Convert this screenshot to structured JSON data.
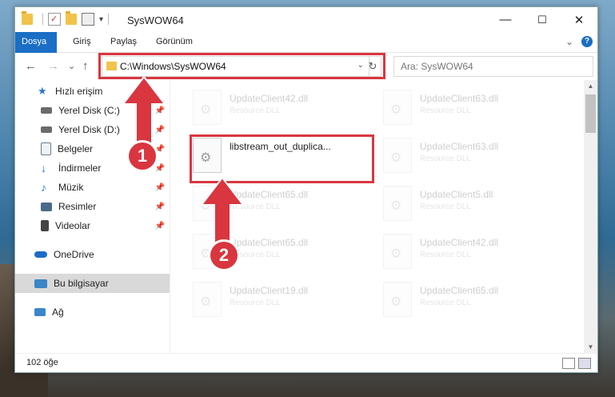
{
  "window": {
    "title": "SysWOW64",
    "controls": {
      "minimize": "—",
      "maximize": "☐",
      "close": "✕"
    }
  },
  "ribbon": {
    "tabs": [
      "Dosya",
      "Giriş",
      "Paylaş",
      "Görünüm"
    ],
    "chevron": "⌄",
    "help": "?"
  },
  "nav": {
    "back": "←",
    "forward": "→",
    "recent": "⌄",
    "up": "↑",
    "address": "C:\\Windows\\SysWOW64",
    "address_chevron": "⌄",
    "refresh": "↻",
    "search_placeholder": "Ara: SysWOW64"
  },
  "sidebar": {
    "items": [
      {
        "label": "Hızlı erişim",
        "icon": "star-icon",
        "color": "#2f78c8"
      },
      {
        "label": "Yerel Disk (C:)",
        "icon": "drive-icon",
        "color": "#555555",
        "pinned": true
      },
      {
        "label": "Yerel Disk (D:)",
        "icon": "drive-icon",
        "color": "#555555",
        "pinned": true
      },
      {
        "label": "Belgeler",
        "icon": "document-icon",
        "color": "#6b7a8f",
        "pinned": true
      },
      {
        "label": "İndirmeler",
        "icon": "download-icon",
        "color": "#1f6fc7",
        "pinned": true
      },
      {
        "label": "Müzik",
        "icon": "music-icon",
        "color": "#2a7fd0",
        "pinned": true
      },
      {
        "label": "Resimler",
        "icon": "pictures-icon",
        "color": "#4a6a8a",
        "pinned": true
      },
      {
        "label": "Videolar",
        "icon": "video-icon",
        "color": "#444444",
        "pinned": true
      },
      {
        "label": "OneDrive",
        "icon": "cloud-icon",
        "color": "#1c6cc6"
      },
      {
        "label": "Bu bilgisayar",
        "icon": "computer-icon",
        "color": "#3a86c8",
        "selected": true
      },
      {
        "label": "Ağ",
        "icon": "network-icon",
        "color": "#3a86c8"
      }
    ],
    "pin_glyph": "📌"
  },
  "files": [
    {
      "name": "UpdateClient42.dll",
      "type": "Resource DLL",
      "faded": true
    },
    {
      "name": "UpdateClient63.dll",
      "type": "Resource DLL",
      "faded": true
    },
    {
      "name": "libstream_out_duplica...",
      "type": "",
      "faded": false
    },
    {
      "name": "UpdateClient63.dll",
      "type": "Resource DLL",
      "faded": true
    },
    {
      "name": "UpdateClient65.dll",
      "type": "Resource DLL",
      "faded": true
    },
    {
      "name": "UpdateClient5.dll",
      "type": "Resource DLL",
      "faded": true
    },
    {
      "name": "UpdateClient65.dll",
      "type": "Resource DLL",
      "faded": true
    },
    {
      "name": "UpdateClient42.dll",
      "type": "Resource DLL",
      "faded": true
    },
    {
      "name": "UpdateClient19.dll",
      "type": "Resource DLL",
      "faded": true
    },
    {
      "name": "UpdateClient65.dll",
      "type": "Resource DLL",
      "faded": true
    }
  ],
  "status": {
    "count": "102 öğe"
  },
  "annotations": {
    "step1": "1",
    "step2": "2",
    "accent": "#d9363f"
  },
  "scrollbar": {
    "up": "▲",
    "down": "▼"
  }
}
